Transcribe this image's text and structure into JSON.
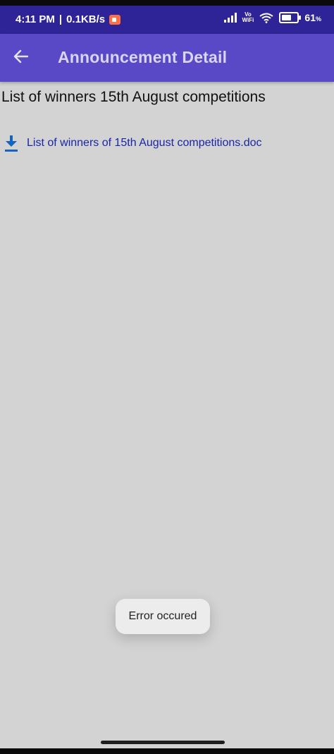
{
  "status_bar": {
    "time": "4:11 PM",
    "separator": "|",
    "network_speed": "0.1KB/s",
    "vo_label": "Vo",
    "wifi_label": "WiFi",
    "battery_value": "61",
    "battery_unit": "%",
    "battery_level": 0.61
  },
  "app_bar": {
    "title": "Announcement Detail",
    "back_icon": "arrow-left-icon"
  },
  "announcement": {
    "title": "List of winners 15th August competitions",
    "attachment": {
      "icon": "download-icon",
      "name": "List of winners of 15th August competitions.doc",
      "link_color": "#1a26a7"
    }
  },
  "toast": {
    "message": "Error occured"
  },
  "colors": {
    "status_bar": "#2f2497",
    "app_bar": "#5a49c6",
    "background": "#d3d3d3",
    "download_icon": "#1565c0"
  }
}
